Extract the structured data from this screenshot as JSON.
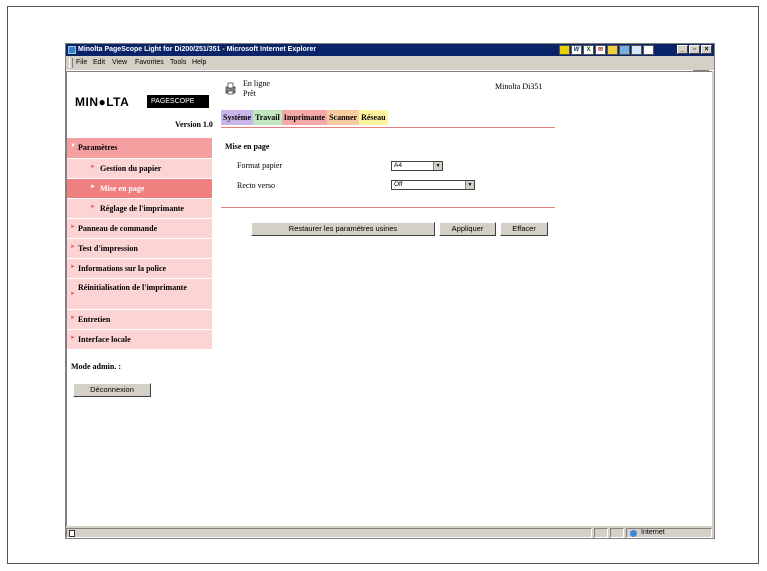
{
  "window": {
    "title": "Minolta PageScope Light for Di200/251/351 - Microsoft Internet Explorer",
    "menu": [
      "File",
      "Edit",
      "View",
      "Favorites",
      "Tools",
      "Help"
    ]
  },
  "header": {
    "brand": "MIN●LTA",
    "product": "PAGESCOPE Light",
    "version": "Version 1.0",
    "status_line1": "En ligne",
    "status_line2": "Prêt",
    "model": "Minolta Di351"
  },
  "tabs": [
    "Système",
    "Travail",
    "Imprimante",
    "Scanner",
    "Réseau"
  ],
  "sidebar": {
    "items": [
      {
        "label": "Paramètres"
      },
      {
        "label": "Gestion du papier"
      },
      {
        "label": "Mise en page"
      },
      {
        "label": "Réglage de l'imprimante"
      },
      {
        "label": "Panneau de commande"
      },
      {
        "label": "Test d'impression"
      },
      {
        "label": "Informations sur la police"
      },
      {
        "label": "Réinitialisation de l'imprimante"
      },
      {
        "label": "Entretien"
      },
      {
        "label": "Interface locale"
      }
    ],
    "admin_label": "Mode admin. :",
    "logout_label": "Déconnexion"
  },
  "main": {
    "section_title": "Mise en page",
    "fields": [
      {
        "label": "Format papier",
        "value": "A4"
      },
      {
        "label": "Recto verso",
        "value": "Off"
      }
    ],
    "buttons": {
      "restore": "Restaurer les paramètres usines",
      "apply": "Appliquer",
      "clear": "Effacer"
    }
  },
  "statusbar": {
    "zone": "Internet"
  },
  "colors": {
    "titlebar": "#0a246a",
    "nav_active": "#f08080",
    "nav_item": "#fcd4d4",
    "divider": "#e88080"
  }
}
